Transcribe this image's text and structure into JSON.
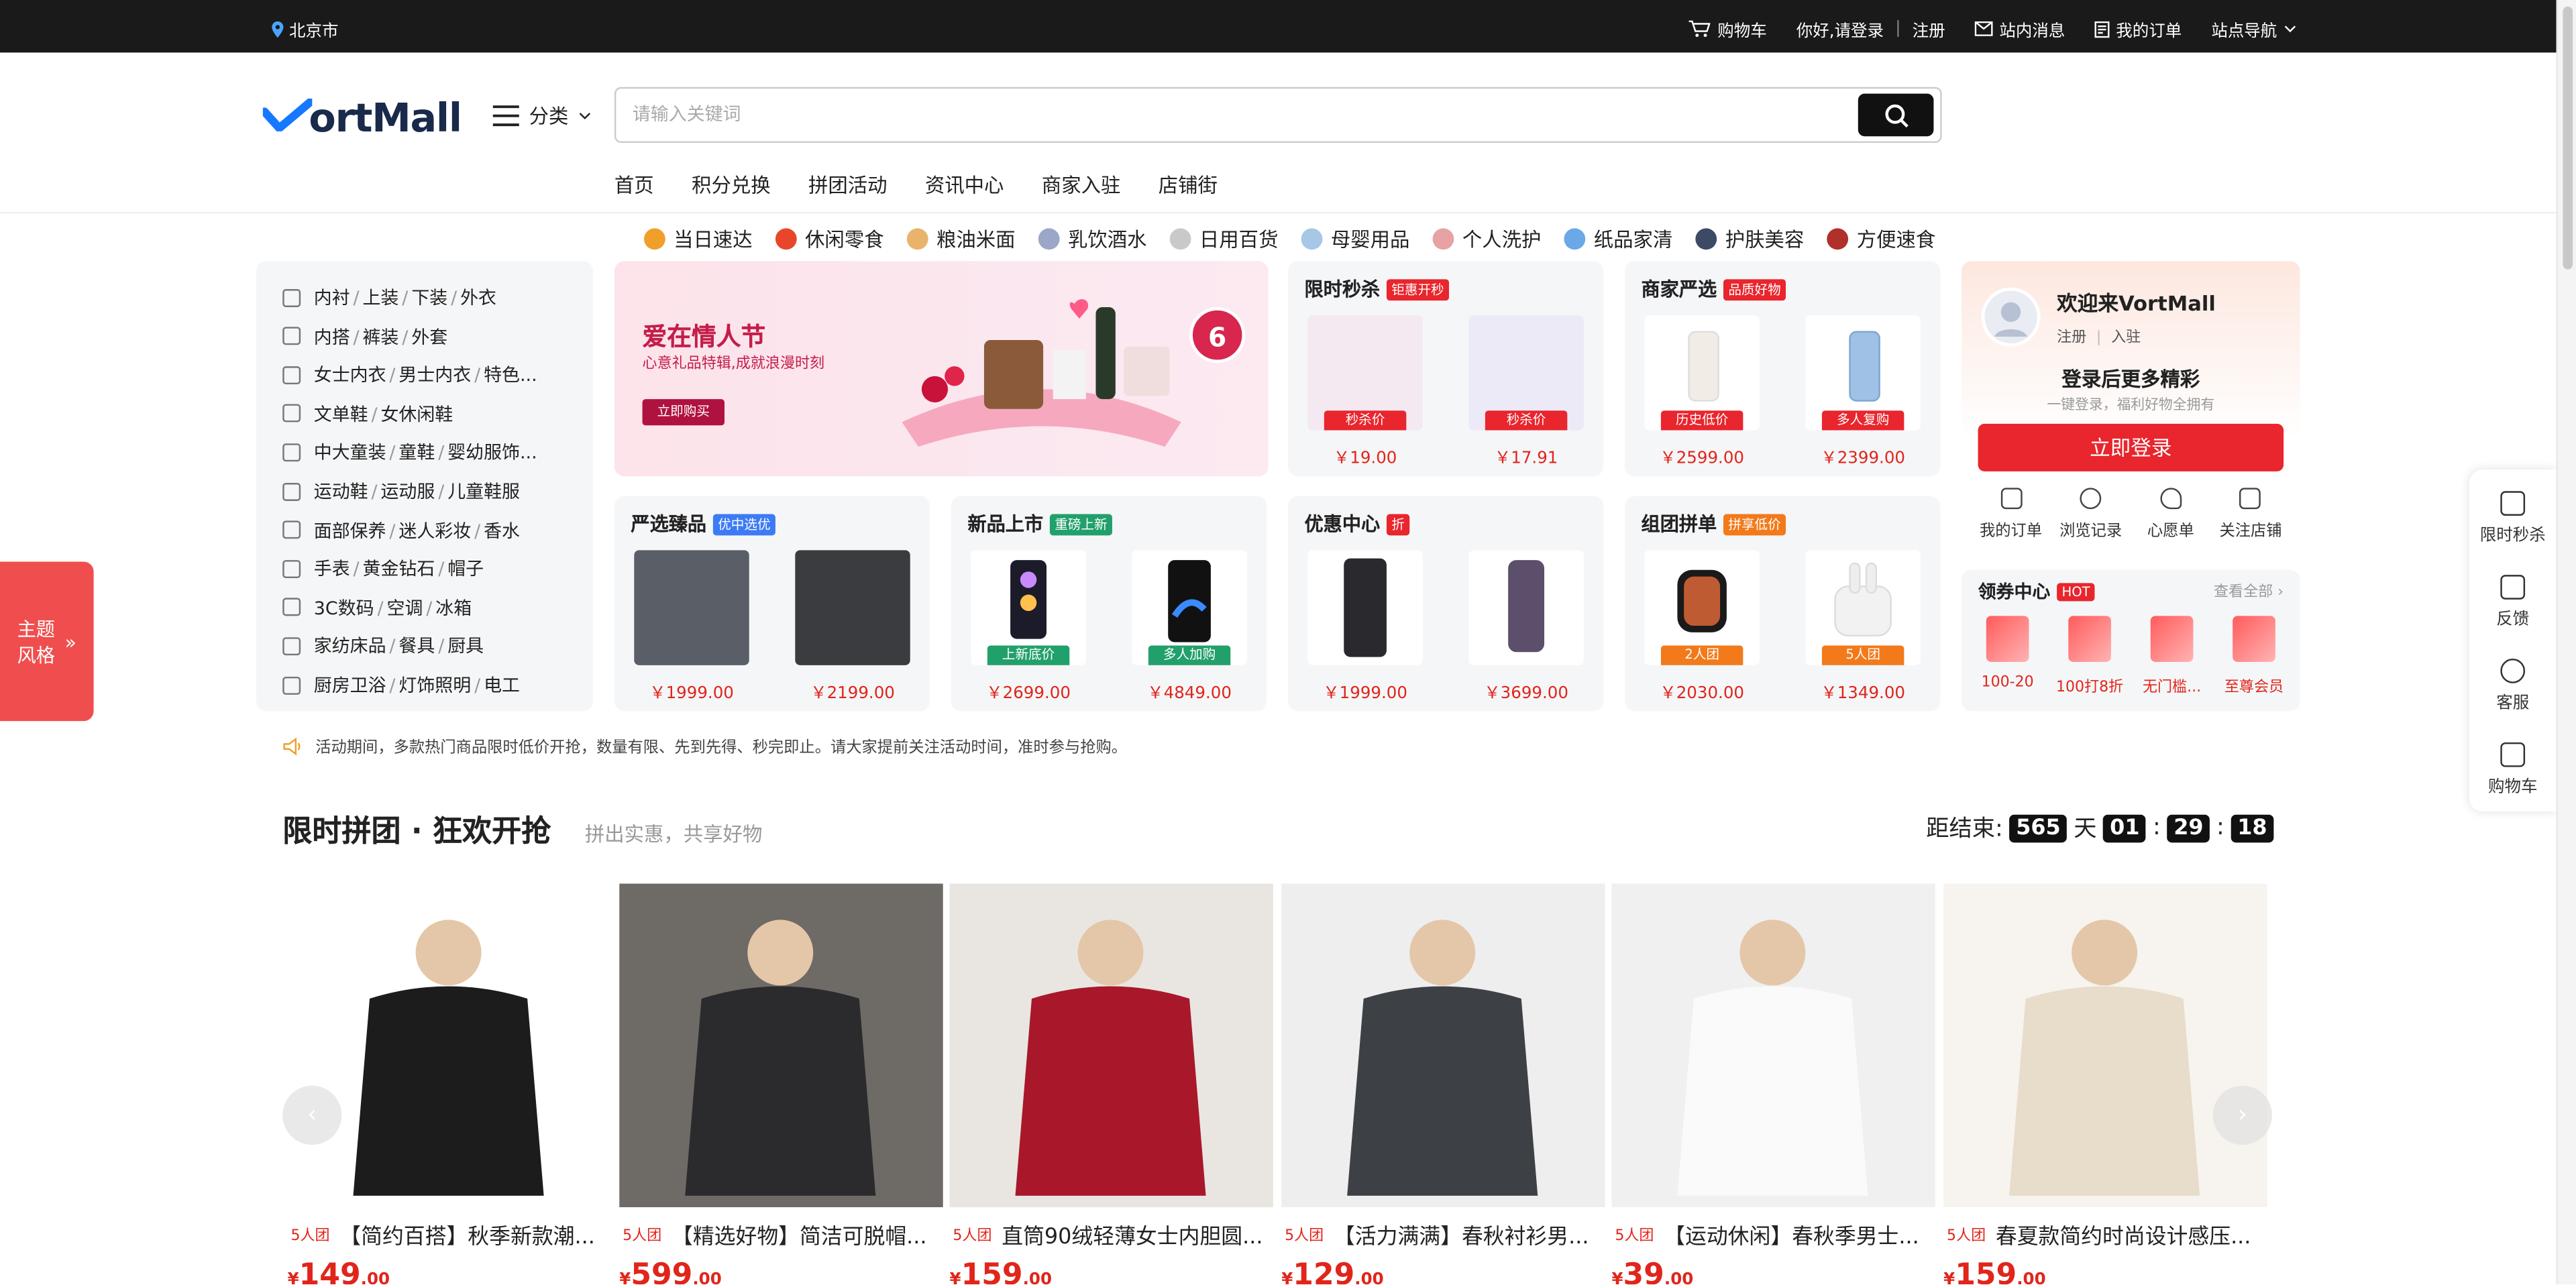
{
  "topbar": {
    "location": "北京市",
    "cart": "购物车",
    "greeting": "你好,请登录",
    "register": "注册",
    "messages": "站内消息",
    "orders": "我的订单",
    "site_nav": "站点导航"
  },
  "header": {
    "logo_text": "ortMall",
    "category": "分类",
    "search_placeholder": "请输入关键词",
    "nav": [
      "首页",
      "积分兑换",
      "拼团活动",
      "资讯中心",
      "商家入驻",
      "店铺街"
    ]
  },
  "quick_cats": [
    "当日速达",
    "休闲零食",
    "粮油米面",
    "乳饮酒水",
    "日用百货",
    "母婴用品",
    "个人洗护",
    "纸品家清",
    "护肤美容",
    "方便速食"
  ],
  "left_categories": [
    [
      "内衬",
      "上装",
      "下装",
      "外衣"
    ],
    [
      "内搭",
      "裤装",
      "外套"
    ],
    [
      "女士内衣",
      "男士内衣",
      "特色..."
    ],
    [
      "文单鞋",
      "女休闲鞋"
    ],
    [
      "中大童装",
      "童鞋",
      "婴幼服饰..."
    ],
    [
      "运动鞋",
      "运动服",
      "儿童鞋服"
    ],
    [
      "面部保养",
      "迷人彩妆",
      "香水"
    ],
    [
      "手表",
      "黄金钻石",
      "帽子"
    ],
    [
      "3C数码",
      "空调",
      "冰箱"
    ],
    [
      "家纺床品",
      "餐具",
      "厨具"
    ],
    [
      "厨房卫浴",
      "灯饰照明",
      "电工"
    ]
  ],
  "banner": {
    "title": "爱在情人节",
    "subtitle": "心意礼品特辑,成就浪漫时刻",
    "button": "立即购买",
    "discount": "6"
  },
  "cards": {
    "flash": {
      "title": "限时秒杀",
      "tag": "钜惠开秒",
      "p1": "￥19.00",
      "p2": "￥17.91",
      "l1": "秒杀价",
      "l2": "秒杀价"
    },
    "merchant": {
      "title": "商家严选",
      "tag": "品质好物",
      "p1": "￥2599.00",
      "p2": "￥2399.00",
      "l1": "历史低价",
      "l2": "多人复购"
    },
    "select": {
      "title": "严选臻品",
      "tag": "优中选优",
      "p1": "￥1999.00",
      "p2": "￥2199.00"
    },
    "newp": {
      "title": "新品上市",
      "tag": "重磅上新",
      "p1": "￥2699.00",
      "p2": "￥4849.00",
      "l1": "上新底价",
      "l2": "多人加购"
    },
    "discount": {
      "title": "优惠中心",
      "tag": "折",
      "p1": "￥1999.00",
      "p2": "￥3699.00"
    },
    "group": {
      "title": "组团拼单",
      "tag": "拼享低价",
      "p1": "￥2030.00",
      "p2": "￥1349.00",
      "l1": "2人团",
      "l2": "5人团"
    }
  },
  "welcome": {
    "title": "欢迎来VortMall",
    "register": "注册",
    "join": "入驻",
    "headline": "登录后更多精彩",
    "sub": "一键登录，福利好物全拥有",
    "login": "立即登录",
    "ops": [
      "我的订单",
      "浏览记录",
      "心愿单",
      "关注店铺"
    ]
  },
  "coupon": {
    "title": "领券中心",
    "hot": "HOT",
    "all": "查看全部",
    "items": [
      "100-20",
      "100打8折",
      "无门槛...",
      "至尊会员"
    ]
  },
  "theme": "主题\n风格",
  "sidebar": [
    "限时秒杀",
    "反馈",
    "客服",
    "购物车"
  ],
  "notice": "活动期间，多款热门商品限时低价开抢，数量有限、先到先得、秒完即止。请大家提前关注活动时间，准时参与抢购。",
  "section": {
    "title": "限时拼团 · 狂欢开抢",
    "subtitle": "拼出实惠，共享好物",
    "countdown_label": "距结束:",
    "days": "565",
    "day_unit": "天",
    "hours": "01",
    "minutes": "29",
    "seconds": "18"
  },
  "products": [
    {
      "group": "5人团",
      "name": "【简约百搭】秋季新款潮...",
      "price": "149",
      "cents": ".00"
    },
    {
      "group": "5人团",
      "name": "【精选好物】简洁可脱帽...",
      "price": "599",
      "cents": ".00"
    },
    {
      "group": "5人团",
      "name": "直筒90绒轻薄女士内胆圆...",
      "price": "159",
      "cents": ".00"
    },
    {
      "group": "5人团",
      "name": "【活力满满】春秋衬衫男...",
      "price": "129",
      "cents": ".00"
    },
    {
      "group": "5人团",
      "name": "【运动休闲】春秋季男士...",
      "price": "39",
      "cents": ".00"
    },
    {
      "group": "5人团",
      "name": "春夏款简约时尚设计感压...",
      "price": "159",
      "cents": ".00"
    }
  ],
  "colors": {
    "accent": "#e9252d",
    "price": "#e1251b",
    "topbar": "#1a1a1a"
  }
}
